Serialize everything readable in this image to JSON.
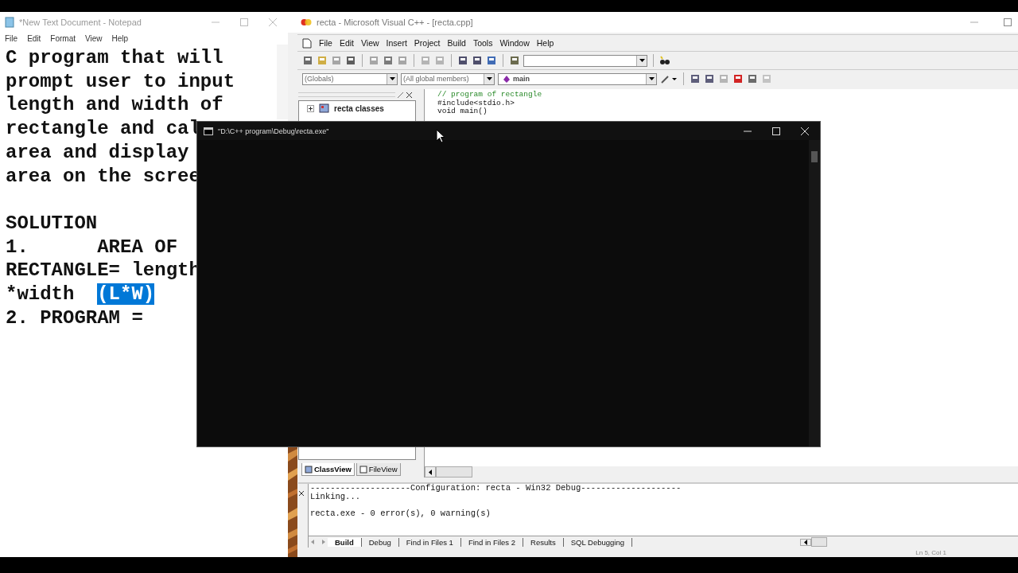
{
  "notepad": {
    "title": "*New Text Document - Notepad",
    "menu": [
      "File",
      "Edit",
      "Format",
      "View",
      "Help"
    ],
    "paragraphs": [
      [
        [
          {
            "text": "C program that will",
            "selected": false
          }
        ],
        [
          {
            "text": "prompt user to input",
            "selected": false
          }
        ],
        [
          {
            "text": "length and width of",
            "selected": false
          }
        ],
        [
          {
            "text": "rectangle and cal",
            "selected": false
          }
        ],
        [
          {
            "text": "area and display",
            "selected": false
          }
        ],
        [
          {
            "text": "area on the scree",
            "selected": false
          }
        ]
      ],
      [
        [
          {
            "text": "SOLUTION",
            "selected": false
          }
        ],
        [
          {
            "text": "1.      AREA OF",
            "selected": false
          }
        ],
        [
          {
            "text": "RECTANGLE= length",
            "selected": false
          }
        ],
        [
          {
            "text": "*width  ",
            "selected": false
          },
          {
            "text": "(L*W)",
            "selected": true
          }
        ],
        [
          {
            "text": "2. PROGRAM =",
            "selected": false
          }
        ]
      ]
    ]
  },
  "ide": {
    "title": "recta - Microsoft Visual C++ - [recta.cpp]",
    "menu": [
      "File",
      "Edit",
      "View",
      "Insert",
      "Project",
      "Build",
      "Tools",
      "Window",
      "Help"
    ],
    "scope_combos": [
      "(Globals)",
      "(All global members)",
      "main"
    ],
    "workspace": {
      "tree": [
        {
          "label": "recta classes",
          "expanded": false
        }
      ],
      "tabs": [
        {
          "label": "ClassView",
          "selected": true
        },
        {
          "label": "FileView",
          "selected": false
        }
      ]
    },
    "code": [
      {
        "text": "// program of rectangle",
        "kind": "comment"
      },
      {
        "text": "#include<stdio.h>",
        "kind": "code"
      },
      {
        "text": "void main()",
        "kind": "code"
      }
    ],
    "output": {
      "groups": [
        [
          "--------------------Configuration: recta - Win32 Debug--------------------",
          "Linking..."
        ],
        [
          "recta.exe - 0 error(s), 0 warning(s)"
        ]
      ],
      "tabs": [
        {
          "label": "Build",
          "selected": true
        },
        {
          "label": "Debug",
          "selected": false
        },
        {
          "label": "Find in Files 1",
          "selected": false
        },
        {
          "label": "Find in Files 2",
          "selected": false
        },
        {
          "label": "Results",
          "selected": false
        },
        {
          "label": "SQL Debugging",
          "selected": false
        }
      ]
    },
    "status": {
      "position": "Ln 5, Col 1"
    }
  },
  "console": {
    "title": "\"D:\\C++ program\\Debug\\recta.exe\""
  }
}
